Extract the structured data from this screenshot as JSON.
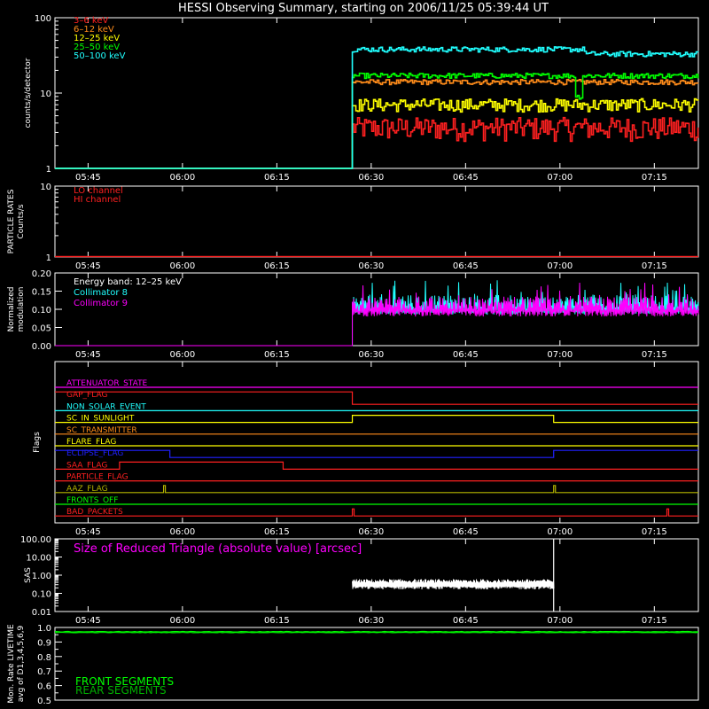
{
  "title": "HESSI Observing Summary, starting on 2006/11/25 05:39:44 UT",
  "time_ticks": [
    "05:45",
    "06:00",
    "06:15",
    "06:30",
    "06:45",
    "07:00",
    "07:15"
  ],
  "colors": {
    "background": "#000000",
    "axes": "#ffffff",
    "red": "#ff2020",
    "orange": "#ff8c1a",
    "yellow": "#ffff00",
    "green": "#00ff00",
    "cyan": "#20ffff",
    "magenta": "#ff00ff",
    "blue": "#2020ff",
    "dark_green": "#00b000",
    "olive": "#b4b400"
  },
  "chart_data": [
    {
      "type": "line",
      "name": "counts",
      "ylabel": "counts/s/detector",
      "yscale": "log",
      "ylim": [
        1,
        100
      ],
      "yticks": [
        "1",
        "10",
        "100"
      ],
      "x_unit": "UT",
      "data_start": "06:27",
      "series": [
        {
          "name": "3–6 keV",
          "color": "#ff2020",
          "before": 1,
          "level": 3.5
        },
        {
          "name": "6–12 keV",
          "color": "#ff8c1a",
          "before": 1,
          "level": 14
        },
        {
          "name": "12–25 keV",
          "color": "#ffff00",
          "before": 1,
          "level": 7
        },
        {
          "name": "25–50 keV",
          "color": "#00ff00",
          "before": 1,
          "level": 17,
          "dip_at": "07:03",
          "dip": 9
        },
        {
          "name": "50–100 keV",
          "color": "#20ffff",
          "before": 1,
          "level": 38,
          "step_at": "07:04",
          "level_after": 33
        }
      ]
    },
    {
      "type": "line",
      "name": "particle-rates",
      "ylabel": "PARTICLE RATES",
      "ylabel2": "Counts/s",
      "yscale": "log",
      "ylim": [
        1,
        10
      ],
      "yticks": [
        "1",
        "10"
      ],
      "series": [
        {
          "name": "LO channel",
          "color": "#ff2020",
          "value": 1
        },
        {
          "name": "HI channel",
          "color": "#ff2020",
          "value": 1
        }
      ]
    },
    {
      "type": "line",
      "name": "modulation",
      "ylabel": "Normalized",
      "ylabel2": "modulation",
      "ylim": [
        0,
        0.2
      ],
      "yticks": [
        "0.00",
        "0.05",
        "0.10",
        "0.15",
        "0.20"
      ],
      "legend_header": "Energy band: 12–25 keV",
      "data_start": "06:27",
      "series": [
        {
          "name": "Collimator 8",
          "color": "#20ffff",
          "base": 0.1
        },
        {
          "name": "Collimator 9",
          "color": "#ff00ff",
          "base": 0.095
        }
      ]
    },
    {
      "type": "line",
      "name": "flags",
      "ylabel": "Flags",
      "flags": [
        {
          "name": "ATTENUATOR_STATE",
          "color": "#ff00ff",
          "steps": []
        },
        {
          "name": "GAP_FLAG",
          "color": "#ff2020",
          "steps": [
            [
              "06:27",
              -1
            ]
          ],
          "initial": 1
        },
        {
          "name": "NON_SOLAR_EVENT",
          "color": "#20ffff",
          "steps": []
        },
        {
          "name": "SC_IN_SUNLIGHT",
          "color": "#ffff00",
          "steps": [
            [
              "06:27",
              1
            ],
            [
              "06:59",
              0
            ]
          ],
          "initial": 0
        },
        {
          "name": "SC_TRANSMITTER",
          "color": "#ff8c1a",
          "steps": []
        },
        {
          "name": "FLARE_FLAG",
          "color": "#ffff00",
          "steps": []
        },
        {
          "name": "ECLIPSE_FLAG",
          "color": "#2020ff",
          "steps": [
            [
              "05:58",
              0
            ],
            [
              "06:59",
              1
            ]
          ],
          "initial": 1
        },
        {
          "name": "SAA_FLAG",
          "color": "#ff2020",
          "steps": [
            [
              "05:50",
              1
            ],
            [
              "06:16",
              0
            ]
          ],
          "initial": 0
        },
        {
          "name": "PARTICLE_FLAG",
          "color": "#ff2020",
          "steps": []
        },
        {
          "name": "AAZ_FLAG",
          "color": "#b4b400",
          "spikes": [
            "05:57",
            "06:59"
          ]
        },
        {
          "name": "FRONTS_OFF",
          "color": "#00ff00",
          "steps": []
        },
        {
          "name": "BAD_PACKETS",
          "color": "#ff2020",
          "spikes": [
            "06:27",
            "07:17"
          ]
        }
      ]
    },
    {
      "type": "line",
      "name": "sas",
      "ylabel": "SAS",
      "yscale": "log",
      "ylim": [
        0.01,
        100
      ],
      "yticks": [
        "0.01",
        "0.10",
        "1.00",
        "10.00",
        "100.00"
      ],
      "annotation": "Size of Reduced Triangle (absolute value) [arcsec]",
      "data_start": "06:27",
      "data_end": "06:59",
      "level": 0.3
    },
    {
      "type": "line",
      "name": "livetime",
      "ylabel": "Mon. Rate LIVETIME",
      "ylabel2": "avg of D1,3,4,5,6,9",
      "ylim": [
        0.5,
        1.0
      ],
      "yticks": [
        "0.5",
        "0.6",
        "0.7",
        "0.8",
        "0.9",
        "1.0"
      ],
      "series": [
        {
          "name": "FRONT SEGMENTS",
          "color": "#00ff00",
          "level": 0.97
        },
        {
          "name": "REAR SEGMENTS",
          "color": "#00b000",
          "level": 0.965
        }
      ]
    }
  ]
}
